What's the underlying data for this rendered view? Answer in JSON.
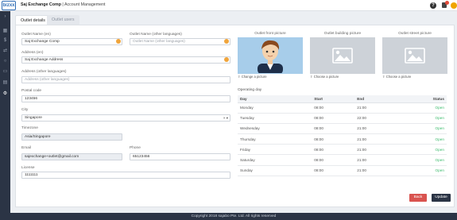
{
  "header": {
    "logo_text": "bizxx",
    "company": "Saj Exchange Comp",
    "separator": " | ",
    "page": "Account Management",
    "help_label": "?",
    "notification_count": "8"
  },
  "tabs": [
    {
      "label": "Outlet details",
      "active": true
    },
    {
      "label": "Outlet users",
      "active": false
    }
  ],
  "form": {
    "outlet_name_label": "Outlet Name (en)",
    "outlet_name_value": "Saj Exchange Comp",
    "outlet_name_other_label": "Outlet Name (other languages)",
    "outlet_name_other_placeholder": "Outlet Name (other languages)",
    "address_label": "Address (en)",
    "address_value": "Saj Exchange Address",
    "address_other_label": "Address (other languages)",
    "address_other_placeholder": "Address (other languages)",
    "postal_label": "Postal code",
    "postal_value": "123456",
    "city_label": "City",
    "city_value": "Singapore",
    "city_clear": "×",
    "city_arrow": "▾",
    "timezone_label": "Timezone",
    "timezone_value": "Asia/Singapore",
    "email_label": "Email",
    "email_value": "sajexchange+outlet@gmail.com",
    "phone_label": "Phone",
    "phone_value": "65123456",
    "license_label": "License",
    "license_value": "1111111"
  },
  "pictures": [
    {
      "title": "Outlet front picture",
      "action": "Change a picture"
    },
    {
      "title": "Outlet building picture",
      "action": "Choose a picture"
    },
    {
      "title": "Outlet street picture",
      "action": "Choose a picture"
    }
  ],
  "operating": {
    "title": "Operating day",
    "headers": {
      "day": "Day",
      "start": "Start",
      "end": "End",
      "status": "Status"
    },
    "rows": [
      {
        "day": "Monday",
        "start": "08:00",
        "end": "21:00",
        "status": "Open"
      },
      {
        "day": "Tuesday",
        "start": "08:00",
        "end": "22:00",
        "status": "Open"
      },
      {
        "day": "Wednesday",
        "start": "08:00",
        "end": "21:00",
        "status": "Open"
      },
      {
        "day": "Thursday",
        "start": "08:00",
        "end": "21:00",
        "status": "Open"
      },
      {
        "day": "Friday",
        "start": "08:00",
        "end": "21:00",
        "status": "Open"
      },
      {
        "day": "Saturday",
        "start": "08:00",
        "end": "21:00",
        "status": "Open"
      },
      {
        "day": "Sunday",
        "start": "08:00",
        "end": "21:00",
        "status": "Open"
      }
    ]
  },
  "buttons": {
    "back": "Back",
    "update": "Update"
  },
  "footer": {
    "text": "Copyright 2018 sajabo Pte. Ltd. All rights reserved"
  },
  "colors": {
    "accent": "#f0a53c",
    "sidebar": "#2b3445",
    "open": "#3dbb6e",
    "back": "#d9534f"
  }
}
